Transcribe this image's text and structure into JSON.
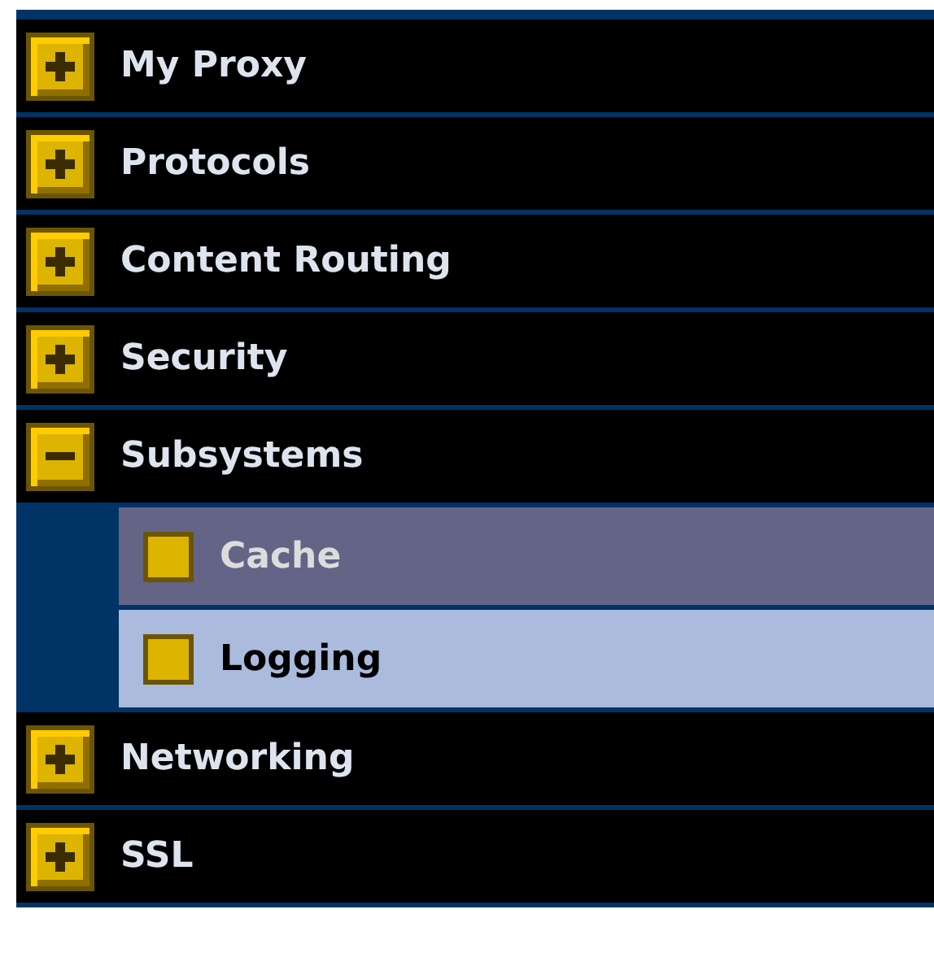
{
  "nav": [
    {
      "label": "My Proxy",
      "expanded": false
    },
    {
      "label": "Protocols",
      "expanded": false
    },
    {
      "label": "Content Routing",
      "expanded": false
    },
    {
      "label": "Security",
      "expanded": false
    },
    {
      "label": "Subsystems",
      "expanded": true,
      "children": [
        {
          "label": "Cache",
          "selected": true
        },
        {
          "label": "Logging",
          "selected": false
        }
      ]
    },
    {
      "label": "Networking",
      "expanded": false
    },
    {
      "label": "SSL",
      "expanded": false
    }
  ]
}
